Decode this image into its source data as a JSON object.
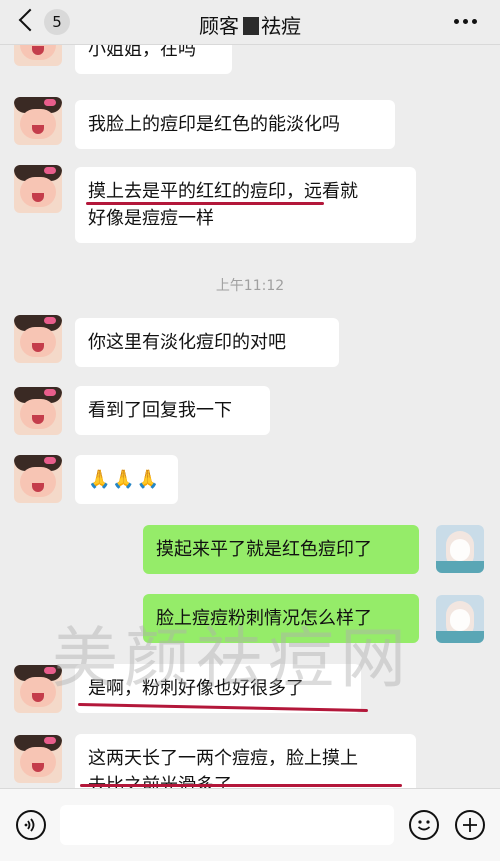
{
  "header": {
    "unread_count": "5",
    "title_prefix": "顾客",
    "title_suffix": "祛痘",
    "icons": {
      "back": "chevron-left-icon",
      "more": "more-dots-icon"
    }
  },
  "messages": [
    {
      "side": "left",
      "text": "小姐姐，在吗"
    },
    {
      "side": "left",
      "text": "我脸上的痘印是红色的能淡化吗"
    },
    {
      "side": "left",
      "text_line1": "摸上去是平的红红的痘印，远看就",
      "text_line2": "好像是痘痘一样"
    },
    {
      "side": "left",
      "text": "你这里有淡化痘印的对吧"
    },
    {
      "side": "left",
      "text": "看到了回复我一下"
    },
    {
      "side": "left",
      "text": "🙏🙏🙏"
    },
    {
      "side": "right",
      "text": "摸起来平了就是红色痘印了"
    },
    {
      "side": "right",
      "text": "脸上痘痘粉刺情况怎么样了"
    },
    {
      "side": "left",
      "text": "是啊，粉刺好像也好很多了"
    },
    {
      "side": "left",
      "text_line1": "这两天长了一两个痘痘，脸上摸上",
      "text_line2": "去比之前光滑多了"
    }
  ],
  "timestamp": "上午11:12",
  "watermark": "美颜祛痘网",
  "bottom_bar": {
    "icons": [
      "voice-icon",
      "emoji-icon",
      "plus-icon"
    ],
    "input_value": ""
  },
  "colors": {
    "background": "#ededed",
    "left_bubble": "#ffffff",
    "right_bubble": "#95ec69",
    "underline": "#b3173a"
  }
}
